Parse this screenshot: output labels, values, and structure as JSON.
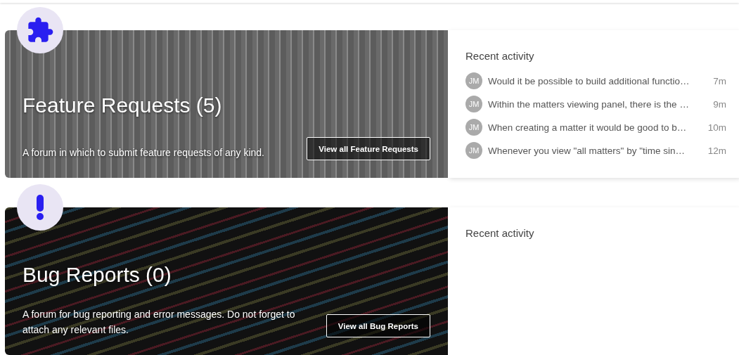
{
  "forums": [
    {
      "kind": "puzzle",
      "title": "Feature Requests (5)",
      "description": "A forum in which to submit feature requests of any kind.",
      "button": "View all Feature Requests",
      "activity_title": "Recent activity",
      "activity": [
        {
          "initials": "JM",
          "text": "Would it be possible to build additional functio…",
          "time": "7m"
        },
        {
          "initials": "JM",
          "text": "Within the matters viewing panel, there is the …",
          "time": "9m"
        },
        {
          "initials": "JM",
          "text": "When creating a matter it would be good to b…",
          "time": "10m"
        },
        {
          "initials": "JM",
          "text": "Whenever you view \"all matters\" by \"time sin…",
          "time": "12m"
        }
      ]
    },
    {
      "kind": "exclamation",
      "title": "Bug Reports (0)",
      "description": "A forum for bug reporting and error messages. Do not forget to attach any relevant files.",
      "button": "View all Bug Reports",
      "activity_title": "Recent activity"
    }
  ]
}
